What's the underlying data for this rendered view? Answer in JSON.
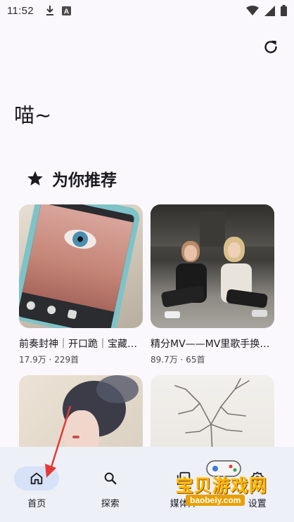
{
  "status_bar": {
    "time": "11:52",
    "left_icons": [
      "download-icon",
      "a-box-icon"
    ],
    "right_icons": [
      "wifi-icon",
      "signal-icon",
      "battery-icon"
    ]
  },
  "header": {
    "refresh_icon": "refresh-icon",
    "greeting": "喵~"
  },
  "recommend": {
    "icon": "star-icon",
    "title": "为你推荐",
    "cards": [
      {
        "title": "前奏封神｜开口跪｜宝藏歌单",
        "plays": "17.9万",
        "count": "229首"
      },
      {
        "title": "精分MV——MV里歌手换人了",
        "plays": "89.7万",
        "count": "65首"
      },
      {
        "title": "",
        "plays": "",
        "count": ""
      },
      {
        "title": "",
        "plays": "",
        "count": ""
      }
    ],
    "meta_separator": " · "
  },
  "bottom_nav": {
    "items": [
      {
        "label": "首页",
        "icon": "home-icon",
        "active": true
      },
      {
        "label": "探索",
        "icon": "search-icon",
        "active": false
      },
      {
        "label": "媒体库",
        "icon": "library-icon",
        "active": false
      },
      {
        "label": "设置",
        "icon": "gear-icon",
        "active": false
      }
    ]
  },
  "watermark": {
    "text": "宝贝游戏网",
    "url": "baobeiy.com"
  },
  "colors": {
    "background": "#fbf8fd",
    "nav_background": "#eef0f8",
    "nav_active_pill": "#d7e1f8",
    "annotation_arrow": "#e53935"
  }
}
